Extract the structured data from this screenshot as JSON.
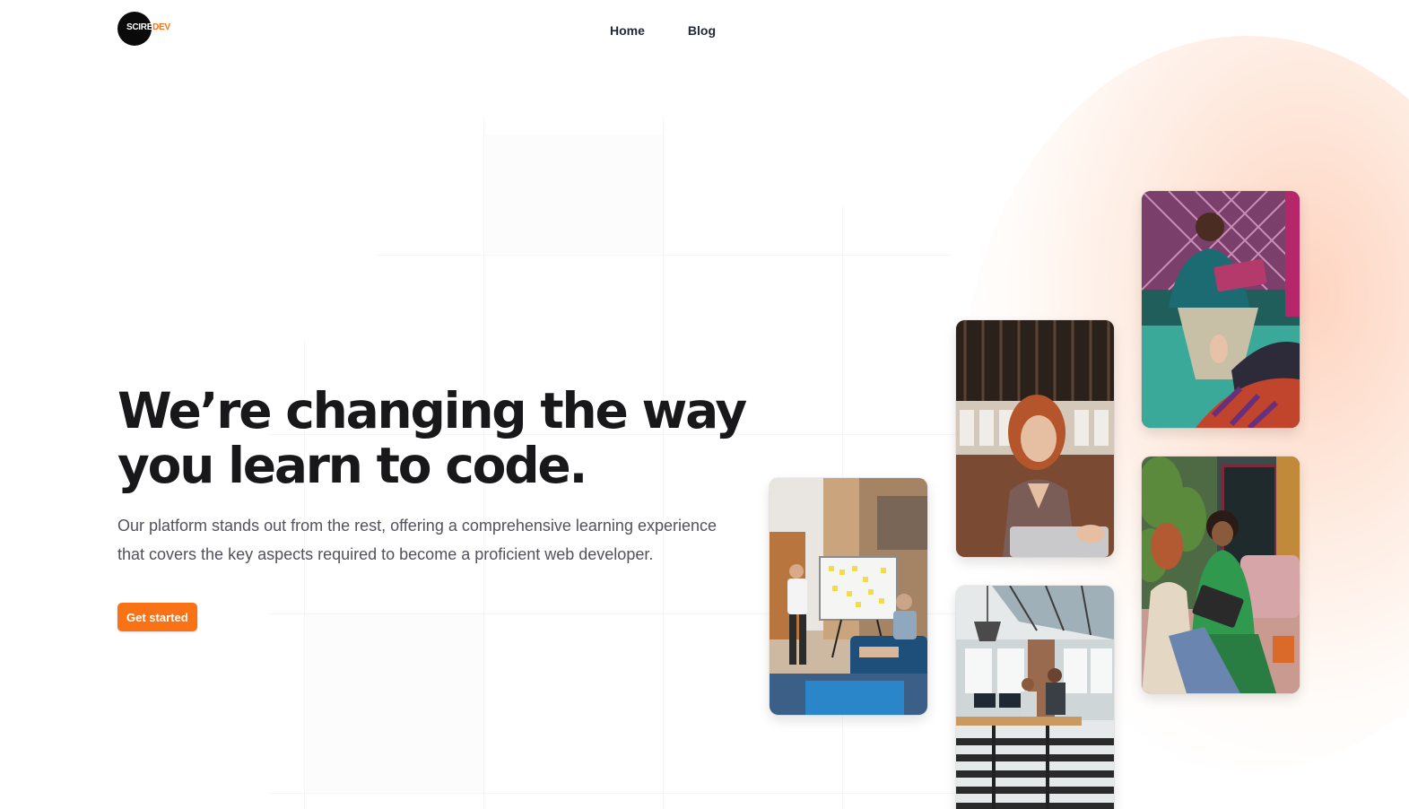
{
  "header": {
    "logo": {
      "prefix": "SCIRE",
      "suffix": "DEV"
    },
    "nav": [
      {
        "label": "Home"
      },
      {
        "label": "Blog"
      }
    ]
  },
  "hero": {
    "title": "We’re changing the way you learn to code.",
    "subtitle": "Our platform stands out from the rest, offering a comprehensive learning experience that covers the key aspects required to become a proficient web developer.",
    "cta_label": "Get started"
  },
  "photos": [
    {
      "name": "photo-whiteboard-meeting"
    },
    {
      "name": "photo-woman-laptop"
    },
    {
      "name": "photo-open-office"
    },
    {
      "name": "photo-man-tablet"
    },
    {
      "name": "photo-women-laughing"
    }
  ],
  "colors": {
    "accent": "#f97316",
    "heading": "#18181b",
    "body": "#52525b"
  }
}
